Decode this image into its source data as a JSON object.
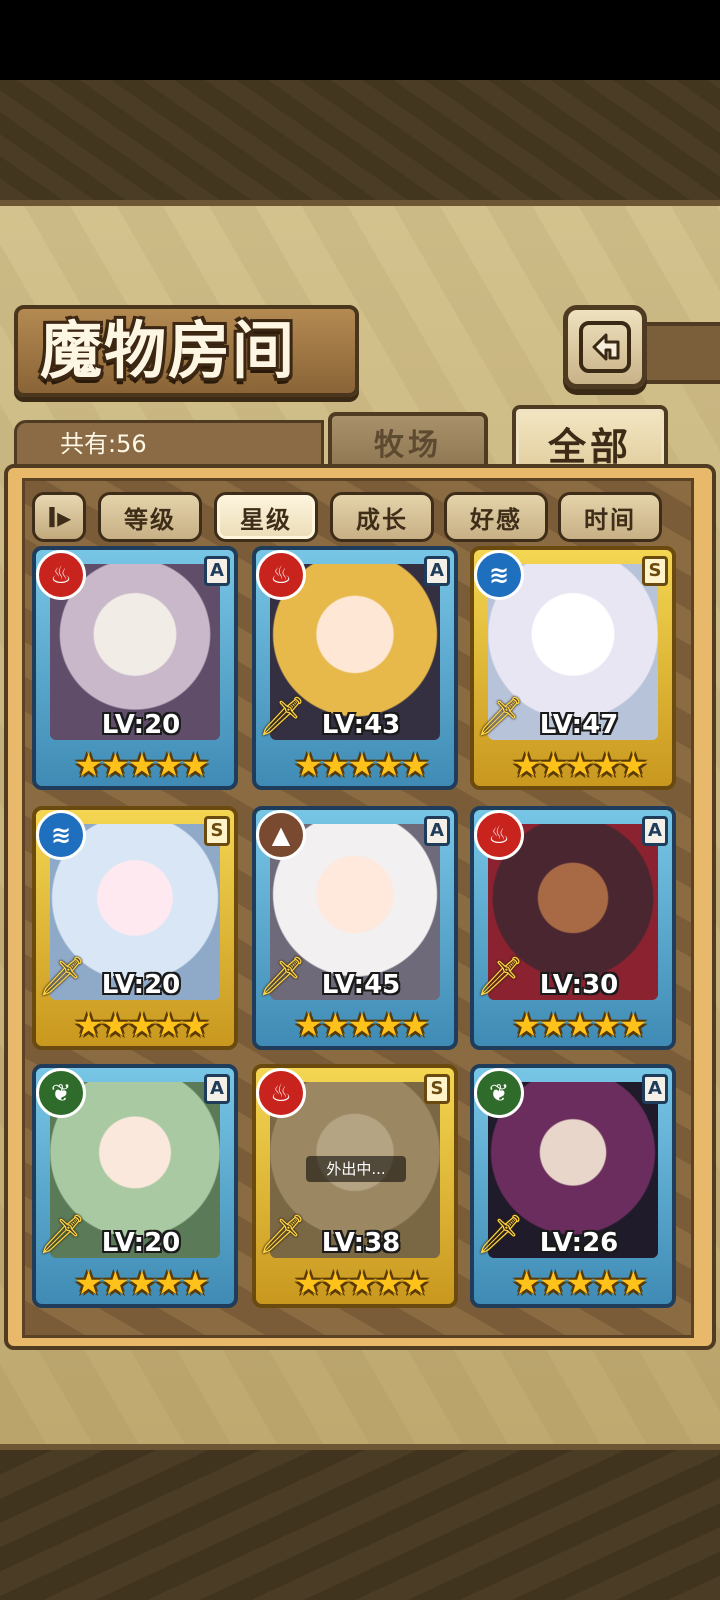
{
  "header": {
    "title": "魔物房间"
  },
  "summary": {
    "count_text": "共有:56"
  },
  "tabs": [
    {
      "label": "牧场",
      "active": false
    },
    {
      "label": "全部",
      "active": true
    }
  ],
  "sort_toggle": {
    "glyph": "I▸"
  },
  "filters": [
    {
      "label": "等级",
      "active": false
    },
    {
      "label": "星级",
      "active": true
    },
    {
      "label": "成长",
      "active": false
    },
    {
      "label": "好感",
      "active": false
    },
    {
      "label": "时间",
      "active": false
    }
  ],
  "monsters": [
    {
      "element": "fire",
      "element_glyph": "♨",
      "element_color": "#c8231d",
      "rank": "A",
      "level": "LV:20",
      "stars": "★★★★★",
      "status": ""
    },
    {
      "element": "fire",
      "element_glyph": "♨",
      "element_color": "#c8231d",
      "rank": "A",
      "level": "LV:43",
      "stars": "★★★★★",
      "status": ""
    },
    {
      "element": "water",
      "element_glyph": "≋",
      "element_color": "#1f6fbf",
      "rank": "S",
      "level": "LV:47",
      "stars": "★★★★★",
      "status": ""
    },
    {
      "element": "water",
      "element_glyph": "≋",
      "element_color": "#1f6fbf",
      "rank": "S",
      "level": "LV:20",
      "stars": "★★★★★",
      "status": ""
    },
    {
      "element": "earth",
      "element_glyph": "▲",
      "element_color": "#7a4a30",
      "rank": "A",
      "level": "LV:45",
      "stars": "★★★★★",
      "status": ""
    },
    {
      "element": "fire",
      "element_glyph": "♨",
      "element_color": "#c8231d",
      "rank": "A",
      "level": "LV:30",
      "stars": "★★★★★",
      "status": ""
    },
    {
      "element": "wind",
      "element_glyph": "❦",
      "element_color": "#2f6b2a",
      "rank": "A",
      "level": "LV:20",
      "stars": "★★★★★",
      "status": ""
    },
    {
      "element": "fire",
      "element_glyph": "♨",
      "element_color": "#c8231d",
      "rank": "S",
      "level": "LV:38",
      "stars": "★★★★★",
      "status": "外出中..."
    },
    {
      "element": "wind",
      "element_glyph": "❦",
      "element_color": "#2f6b2a",
      "rank": "A",
      "level": "LV:26",
      "stars": "★★★★★",
      "status": ""
    }
  ]
}
